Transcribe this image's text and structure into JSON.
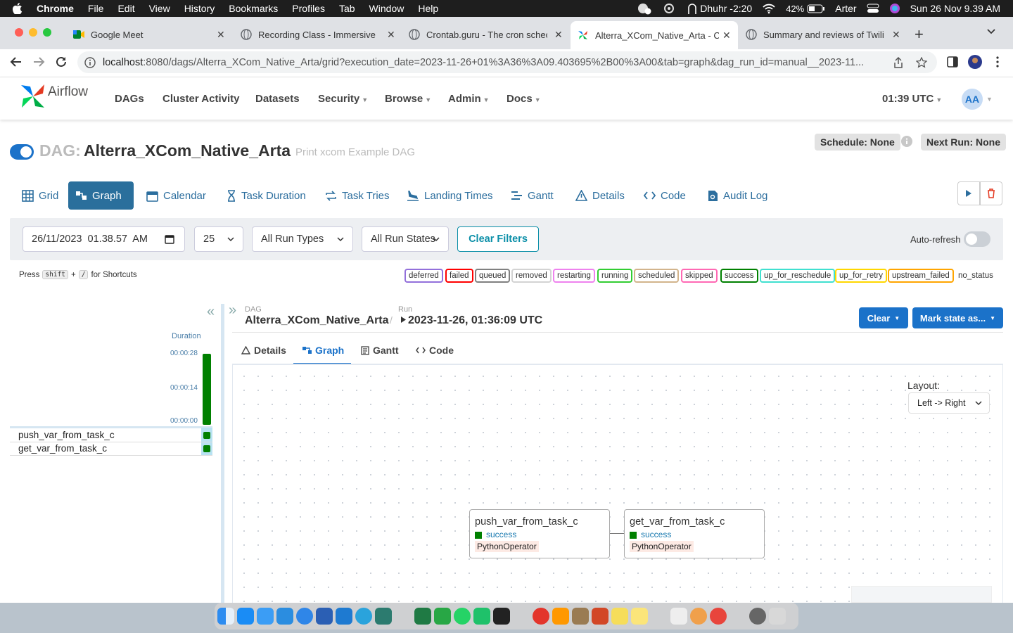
{
  "menubar": {
    "apple": "",
    "items": [
      "Chrome",
      "File",
      "Edit",
      "View",
      "History",
      "Bookmarks",
      "Profiles",
      "Tab",
      "Window",
      "Help"
    ],
    "prayer": "Dhuhr -2:20",
    "battery": "42%",
    "user": "Arter",
    "datetime": "Sun 26 Nov  9.39 AM"
  },
  "browser": {
    "tabs": [
      {
        "title": "Google Meet",
        "icon": "google-meet-icon"
      },
      {
        "title": "Recording Class - Immersive D",
        "icon": "globe-icon"
      },
      {
        "title": "Crontab.guru - The cron schec",
        "icon": "globe-icon"
      },
      {
        "title": "Alterra_XCom_Native_Arta - C",
        "icon": "airflow-icon"
      },
      {
        "title": "Summary and reviews of Twilig",
        "icon": "globe-icon"
      }
    ],
    "url_host": "localhost",
    "url_rest": ":8080/dags/Alterra_XCom_Native_Arta/grid?execution_date=2023-11-26+01%3A36%3A09.403695%2B00%3A00&tab=graph&dag_run_id=manual__2023-11..."
  },
  "nav": {
    "brand": "Airflow",
    "links": [
      "DAGs",
      "Cluster Activity",
      "Datasets",
      "Security",
      "Browse",
      "Admin",
      "Docs"
    ],
    "time": "01:39 UTC",
    "avatar": "AA"
  },
  "dag": {
    "prefix": "DAG:",
    "name": "Alterra_XCom_Native_Arta",
    "description": "Print xcom Example DAG",
    "schedule": "Schedule: None",
    "next_run": "Next Run: None"
  },
  "view_tabs": [
    "Grid",
    "Graph",
    "Calendar",
    "Task Duration",
    "Task Tries",
    "Landing Times",
    "Gantt",
    "Details",
    "Code",
    "Audit Log"
  ],
  "filters": {
    "date": "26/11/2023  01.38.57  AM",
    "count": "25",
    "run_types": "All Run Types",
    "run_states": "All Run States",
    "clear": "Clear Filters",
    "auto_refresh": "Auto-refresh"
  },
  "shortcuts": {
    "press": "Press",
    "shift": "shift",
    "plus": "+",
    "slash": "/",
    "rest": "for Shortcuts"
  },
  "legend": [
    {
      "label": "deferred",
      "color": "#9370db"
    },
    {
      "label": "failed",
      "color": "#ff0000"
    },
    {
      "label": "queued",
      "color": "#808080"
    },
    {
      "label": "removed",
      "color": "#d3d3d3"
    },
    {
      "label": "restarting",
      "color": "#ee82ee"
    },
    {
      "label": "running",
      "color": "#32cd32"
    },
    {
      "label": "scheduled",
      "color": "#d2b48c"
    },
    {
      "label": "skipped",
      "color": "#ff69b4"
    },
    {
      "label": "success",
      "color": "#008000"
    },
    {
      "label": "up_for_reschedule",
      "color": "#40e0d0"
    },
    {
      "label": "up_for_retry",
      "color": "#ffd700"
    },
    {
      "label": "upstream_failed",
      "color": "#ffa500"
    },
    {
      "label": "no_status",
      "color": "#ffffff"
    }
  ],
  "grid": {
    "duration_label": "Duration",
    "ticks": [
      "00:00:28",
      "00:00:14",
      "00:00:00"
    ],
    "tasks": [
      "push_var_from_task_c",
      "get_var_from_task_c"
    ]
  },
  "details": {
    "dag_label": "DAG",
    "dag_name": "Alterra_XCom_Native_Arta",
    "slash": "/",
    "run_label": "Run",
    "run_value": "2023-11-26, 01:36:09 UTC",
    "clear_btn": "Clear",
    "mark_btn": "Mark state as...",
    "tabs": [
      "Details",
      "Graph",
      "Gantt",
      "Code"
    ]
  },
  "graph": {
    "layout_label": "Layout:",
    "layout_value": "Left -> Right",
    "nodes": [
      {
        "name": "push_var_from_task_c",
        "state": "success",
        "operator": "PythonOperator"
      },
      {
        "name": "get_var_from_task_c",
        "state": "success",
        "operator": "PythonOperator"
      }
    ]
  },
  "colors": {
    "primary": "#2a6f9c",
    "success": "#008000",
    "action": "#1b72c9",
    "teal": "#0b8fa8"
  }
}
